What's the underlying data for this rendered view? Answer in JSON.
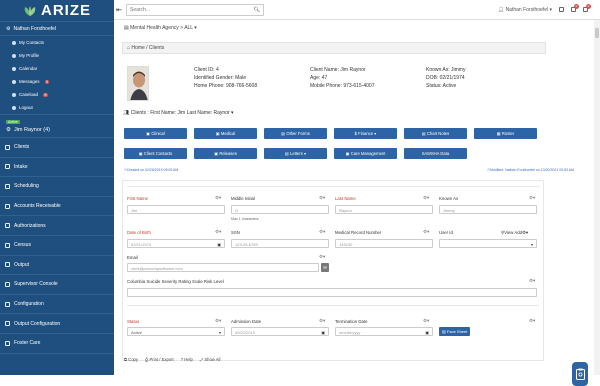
{
  "app": {
    "logo_text": "ARIZE",
    "user": "Nathan Forsthoefel"
  },
  "sidebar": {
    "sub_items": [
      {
        "label": "My Contacts",
        "badge": ""
      },
      {
        "label": "My Profile",
        "badge": ""
      },
      {
        "label": "Calendar",
        "badge": ""
      },
      {
        "label": "Messages",
        "badge": "0"
      },
      {
        "label": "Caseload",
        "badge": "6"
      },
      {
        "label": "Logout",
        "badge": ""
      }
    ],
    "client_status": "Active",
    "client_name": "Jim Raynor (4)",
    "nav": [
      {
        "label": "Clients"
      },
      {
        "label": "Intake"
      },
      {
        "label": "Scheduling"
      },
      {
        "label": "Accounts Receivable"
      },
      {
        "label": "Authorizations"
      },
      {
        "label": "Census"
      },
      {
        "label": "Output"
      },
      {
        "label": "Supervisor Console"
      },
      {
        "label": "Configuration"
      },
      {
        "label": "Output Configuration"
      },
      {
        "label": "Foster Care"
      }
    ]
  },
  "topbar": {
    "search_placeholder": "Search...",
    "user": "Nathan Forsthoefel",
    "notif1": "0",
    "notif2": "0"
  },
  "main": {
    "agency": "Mental Health Agency > ALL",
    "breadcrumb": "Home / Clients",
    "client": {
      "id_line": "Client ID: 4",
      "gender_line": "Identified Gender: Male",
      "home_phone_line": "Home Phone: 908-766-5608",
      "name_line": "Client Name: Jim Raynor",
      "age_line": "Age: 47",
      "mobile_line": "Mobile Phone: 973-615-4007",
      "known_as_line": "Known As: Jimmy",
      "dob_line": "DOB: 02/21/1974",
      "status_line": "Status: Active"
    },
    "section_title": "Clients : First Name: Jim Last Name: Raynor",
    "buttons_row1": [
      "Clinical",
      "Medical",
      "Other Forms",
      "Finance",
      "Chart Notes",
      "Roster"
    ],
    "buttons_row2": [
      "Client Contacts",
      "Releases",
      "Letters",
      "Care Management",
      "SAMSHA Data"
    ],
    "created": "Created on 02/26/2019 09:00 AM",
    "modified": "Modified: Nathan Forsthoefel on 10/20/2021 09:53 AM"
  },
  "form": {
    "first_name": {
      "label": "First Name",
      "value": "Jim"
    },
    "middle_initial": {
      "label": "Middle Initial",
      "value": "G",
      "hint": "Max 1 characters"
    },
    "last_name": {
      "label": "Last Name",
      "value": "Raynor"
    },
    "known_as": {
      "label": "Known As",
      "value": "Jimmy"
    },
    "dob": {
      "label": "Date of Birth",
      "value": "02/21/1974"
    },
    "ssn": {
      "label": "SSN",
      "value": "123-45-6789"
    },
    "mrn": {
      "label": "Medical Record Number",
      "value": "145230"
    },
    "user_id": {
      "label": "User Id",
      "value": "",
      "view": "View",
      "add": "Add"
    },
    "email": {
      "label": "Email",
      "value": "chris@procompsoftware.com"
    },
    "risk": {
      "label": "Columbia Suicide Severity Rating Scale Risk Level",
      "value": ""
    },
    "status": {
      "label": "Status",
      "value": "Active"
    },
    "admission": {
      "label": "Admission Date",
      "value": "09/22/2019"
    },
    "termination": {
      "label": "Termination Date",
      "value": "mm/dd/yyyy"
    },
    "face_sheet": "Face Sheet"
  },
  "bottom": {
    "copy": "Copy",
    "print": "Print / Export",
    "help": "Help",
    "show_all": "Show All"
  },
  "colors": {
    "sidebar": "#1f4f7e",
    "button": "#2d64a6",
    "required": "#c0392b"
  }
}
